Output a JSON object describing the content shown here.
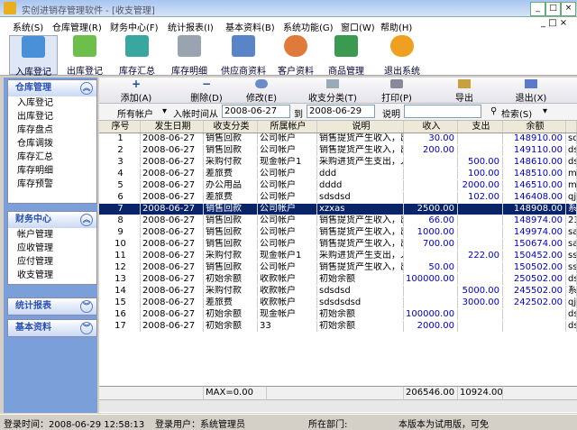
{
  "window": {
    "title": "实创进销存管理软件 - [收支管理]",
    "min": "_",
    "max": "□",
    "close": "×"
  },
  "menu": [
    "系统(S)",
    "仓库管理(R)",
    "财务中心(F)",
    "统计报表(I)",
    "基本资料(B)",
    "系统功能(G)",
    "窗口(W)",
    "帮助(H)"
  ],
  "toolbar": [
    "入库登记",
    "出库登记",
    "库存汇总",
    "库存明细",
    "供应商资料",
    "客户资料",
    "商品管理",
    "退出系统"
  ],
  "sidebar": {
    "warehouse": {
      "title": "仓库管理",
      "items": [
        "入库登记",
        "出库登记",
        "库存盘点",
        "仓库调拨",
        "库存汇总",
        "库存明细",
        "库存预警"
      ]
    },
    "finance": {
      "title": "财务中心",
      "items": [
        "帐户管理",
        "应收管理",
        "应付管理",
        "收支管理"
      ]
    },
    "stats": {
      "title": "统计报表"
    },
    "basic": {
      "title": "基本资料"
    }
  },
  "actions": [
    "添加(A)",
    "删除(D)",
    "修改(E)",
    "收支分类(T)",
    "打印(P)",
    "导出",
    "退出(X)"
  ],
  "filter": {
    "account": "所有帐户",
    "time_label": "入帐时间从",
    "from": "2008-06-27",
    "to_label": "到",
    "to": "2008-06-29",
    "note_label": "说明",
    "search": "检索(S)"
  },
  "table": {
    "headers": [
      "序号",
      "发生日期",
      "收支分类",
      "所属帐户",
      "说明",
      "收入",
      "支出",
      "余额",
      ""
    ],
    "rows": [
      [
        "1",
        "2008-06-27",
        "销售回款",
        "公司帐户",
        "销售提货产生收入，出",
        "30.00",
        "",
        "148910.00",
        "sd"
      ],
      [
        "2",
        "2008-06-27",
        "销售回款",
        "公司帐户",
        "销售提货产生收入，出",
        "200.00",
        "",
        "149110.00",
        "ds"
      ],
      [
        "3",
        "2008-06-27",
        "采购付款",
        "现金帐户1",
        "采购进货产生支出，入",
        "",
        "500.00",
        "148610.00",
        "ds"
      ],
      [
        "4",
        "2008-06-27",
        "差旅费",
        "公司帐户",
        "ddd",
        "",
        "100.00",
        "148510.00",
        "mm"
      ],
      [
        "5",
        "2008-06-27",
        "办公用品",
        "公司帐户",
        "dddd",
        "",
        "2000.00",
        "146510.00",
        "mm"
      ],
      [
        "6",
        "2008-06-27",
        "差旅费",
        "公司帐户",
        "sdsdsd",
        "",
        "102.00",
        "146408.00",
        "qj"
      ],
      [
        "7",
        "2008-06-27",
        "销售回款",
        "公司帐户",
        "xzxas",
        "2500.00",
        "",
        "148908.00",
        "系"
      ],
      [
        "8",
        "2008-06-27",
        "销售回款",
        "公司帐户",
        "销售提货产生收入，出",
        "66.00",
        "",
        "148974.00",
        "23"
      ],
      [
        "9",
        "2008-06-27",
        "销售回款",
        "公司帐户",
        "销售提货产生收入，出",
        "1000.00",
        "",
        "149974.00",
        "sa"
      ],
      [
        "10",
        "2008-06-27",
        "销售回款",
        "公司帐户",
        "销售提货产生收入，出",
        "700.00",
        "",
        "150674.00",
        "sa"
      ],
      [
        "11",
        "2008-06-27",
        "采购付款",
        "现金帐户1",
        "采购进货产生支出，入",
        "",
        "222.00",
        "150452.00",
        "ss"
      ],
      [
        "12",
        "2008-06-27",
        "销售回款",
        "公司帐户",
        "销售提货产生收入，出",
        "50.00",
        "",
        "150502.00",
        "ss"
      ],
      [
        "13",
        "2008-06-27",
        "初始余额",
        "收款帐户",
        "初始余额",
        "100000.00",
        "",
        "250502.00",
        "ds"
      ],
      [
        "14",
        "2008-06-27",
        "采购付款",
        "收款帐户",
        "sdsdsd",
        "",
        "5000.00",
        "245502.00",
        "系"
      ],
      [
        "15",
        "2008-06-27",
        "差旅费",
        "收款帐户",
        "sdsdsdsd",
        "",
        "3000.00",
        "242502.00",
        "qj"
      ],
      [
        "16",
        "2008-06-27",
        "初始余额",
        "现金帐户",
        "初始余额",
        "100000.00",
        "",
        "",
        "ds"
      ],
      [
        "17",
        "2008-06-27",
        "初始余额",
        "33",
        "初始余额",
        "2000.00",
        "",
        "",
        "ds"
      ]
    ],
    "selected_row": "7",
    "totals": {
      "max": "MAX=0.00",
      "income": "206546.00",
      "expense": "10924.00"
    }
  },
  "status": {
    "login_time": "登录时间：2008-06-29 12:58:13",
    "user": "登录用户：系统管理员",
    "dept": "所在部门:",
    "note": "本版本为试用版，可免"
  }
}
